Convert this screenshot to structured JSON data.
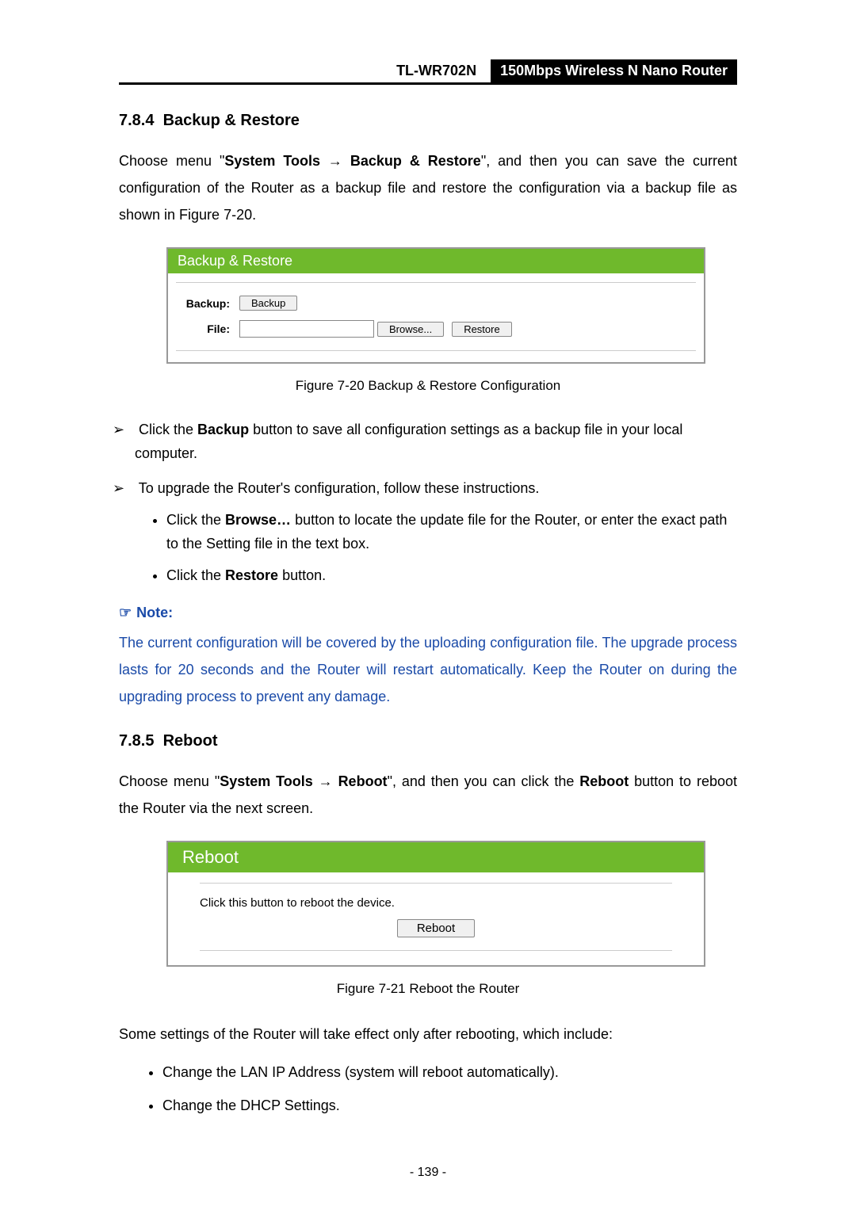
{
  "header": {
    "model": "TL-WR702N",
    "desc": "150Mbps Wireless N Nano Router"
  },
  "section_784": {
    "number": "7.8.4",
    "title": "Backup & Restore",
    "intro_pre": "Choose menu \"",
    "intro_bold1": "System Tools",
    "intro_arrow": " → ",
    "intro_bold2": "Backup & Restore",
    "intro_post": "\", and then you can save the current configuration of the Router as a backup file and restore the configuration via a backup file as shown in Figure 7-20."
  },
  "fig720": {
    "panel_title": "Backup & Restore",
    "row_backup_label": "Backup:",
    "row_backup_button": "Backup",
    "row_file_label": "File:",
    "file_value": "",
    "browse_button": "Browse...",
    "restore_button": "Restore",
    "caption": "Figure 7-20   Backup & Restore Configuration"
  },
  "bullets_784": {
    "b1_pre": "Click the ",
    "b1_bold": "Backup",
    "b1_post": " button to save all configuration settings as a backup file in your local computer.",
    "b2": "To upgrade the Router's configuration, follow these instructions.",
    "b2_s1_pre": "Click the ",
    "b2_s1_bold": "Browse…",
    "b2_s1_post": " button to locate the update file for the Router, or enter the exact path to the Setting file in the text box.",
    "b2_s2_pre": "Click the ",
    "b2_s2_bold": "Restore",
    "b2_s2_post": " button."
  },
  "note": {
    "label": "Note:",
    "body": "The current configuration will be covered by the uploading configuration file. The upgrade process lasts for 20 seconds and the Router will restart automatically. Keep the Router on during the upgrading process to prevent any damage."
  },
  "section_785": {
    "number": "7.8.5",
    "title": "Reboot",
    "intro_pre": "Choose menu \"",
    "intro_bold1": "System Tools",
    "intro_arrow": " → ",
    "intro_bold2": "Reboot",
    "intro_mid": "\", and then you can click the ",
    "intro_bold3": "Reboot",
    "intro_post": " button to reboot the Router via the next screen."
  },
  "fig721": {
    "panel_title": "Reboot",
    "text": "Click this button to reboot the device.",
    "button": "Reboot",
    "caption": "Figure 7-21 Reboot the Router"
  },
  "post_reboot": {
    "lead": "Some settings of the Router will take effect only after rebooting, which include:",
    "i1": "Change the LAN IP Address (system will reboot automatically).",
    "i2": "Change the DHCP Settings."
  },
  "footer": "- 139 -"
}
